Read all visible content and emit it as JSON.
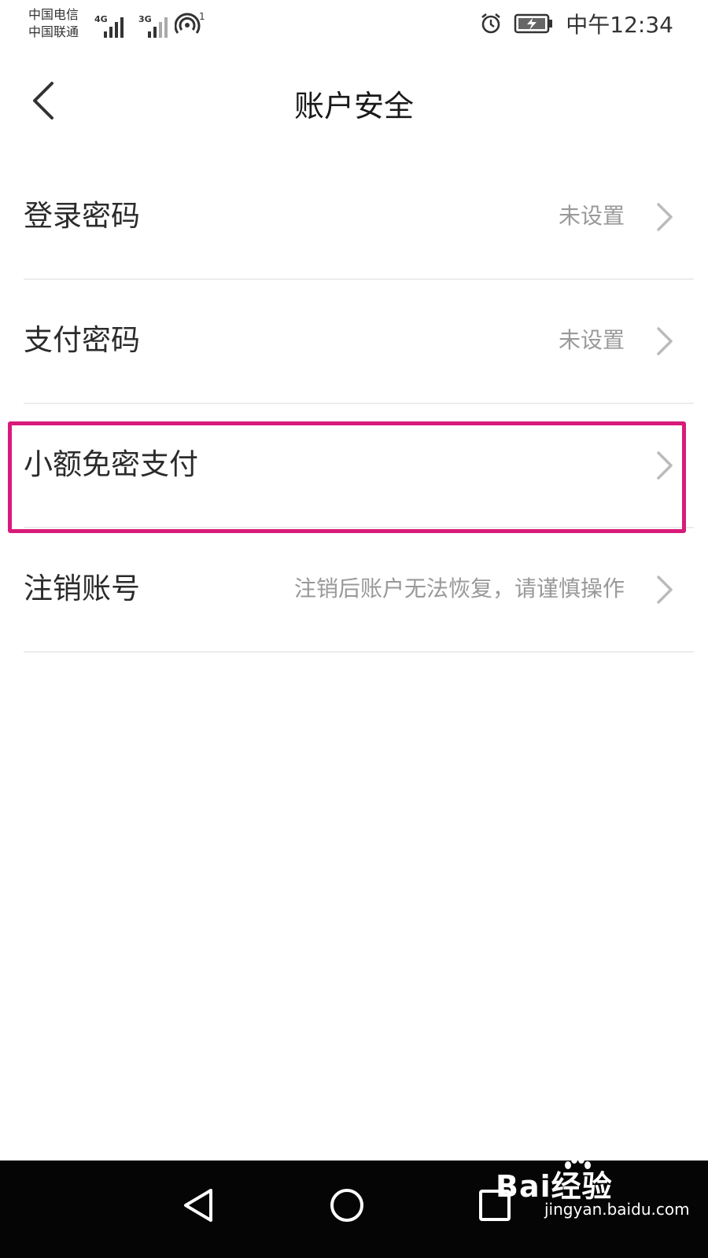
{
  "status_bar": {
    "carrier_1": "中国电信",
    "carrier_2": "中国联通",
    "network_1": "4G",
    "network_2": "3G",
    "hotspot_count": "1",
    "time": "中午12:34",
    "icons": [
      "signal-icon",
      "hotspot-icon",
      "alarm-icon",
      "battery-charging-icon"
    ]
  },
  "header": {
    "title": "账户安全",
    "back_icon": "chevron-left-icon"
  },
  "list": {
    "items": [
      {
        "label": "登录密码",
        "value": "未设置"
      },
      {
        "label": "支付密码",
        "value": "未设置"
      },
      {
        "label": "小额免密支付",
        "value": ""
      },
      {
        "label": "注销账号",
        "value": "注销后账户无法恢复，请谨慎操作"
      }
    ],
    "highlight_color": "#d81b7a"
  },
  "nav_bar": {
    "buttons": [
      "back-triangle-icon",
      "home-circle-icon",
      "recents-square-icon"
    ]
  },
  "watermark": {
    "brand": "Bai经验",
    "url": "jingyan.baidu.com"
  }
}
